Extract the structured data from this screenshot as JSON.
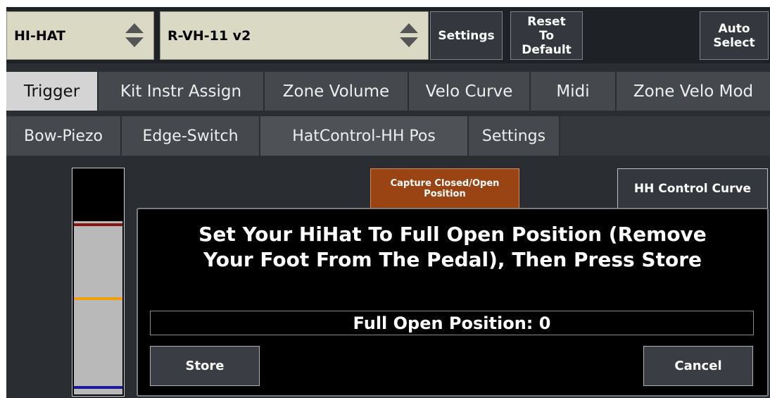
{
  "topbar": {
    "instrument": {
      "value": "HI-HAT"
    },
    "trigger_type": {
      "value": "R-VH-11 v2"
    },
    "settings_label": "Settings",
    "reset_label": [
      "Reset",
      "To",
      "Default"
    ],
    "auto_select_label": [
      "Auto",
      "Select"
    ]
  },
  "main_tabs": [
    {
      "label": "Trigger",
      "active": true
    },
    {
      "label": "Kit Instr Assign",
      "active": false
    },
    {
      "label": "Zone Volume",
      "active": false
    },
    {
      "label": "Velo Curve",
      "active": false
    },
    {
      "label": "Midi",
      "active": false
    },
    {
      "label": "Zone Velo Mod",
      "active": false
    }
  ],
  "sub_tabs": [
    {
      "label": "Bow-Piezo",
      "active": false
    },
    {
      "label": "Edge-Switch",
      "active": false
    },
    {
      "label": "HatControl-HH Pos",
      "active": true
    },
    {
      "label": "Settings",
      "active": false
    }
  ],
  "meter": {
    "fill_fraction": 0.77,
    "markers": [
      {
        "name": "closed-marker",
        "fraction": 0.75,
        "color": "#8b1515"
      },
      {
        "name": "mid-marker",
        "fraction": 0.42,
        "color": "#f0a000"
      },
      {
        "name": "open-marker",
        "fraction": 0.025,
        "color": "#1a1a9a"
      }
    ]
  },
  "actions": {
    "capture_label": [
      "Capture Closed/Open",
      "Position"
    ],
    "curve_label": "HH Control Curve"
  },
  "dialog": {
    "message_lines": [
      "Set Your HiHat To Full Open Position (Remove",
      "Your Foot From The Pedal), Then Press Store"
    ],
    "field_label": "Full Open Position:",
    "field_value": "0",
    "store_label": "Store",
    "cancel_label": "Cancel"
  },
  "colors": {
    "background": "#2a2e33",
    "selector_bg": "#dad9c4",
    "active_tab": "#d4d4d4",
    "capture_button": "#9a4313"
  },
  "icons": {
    "selector_arrows": "updown-arrows-icon"
  }
}
